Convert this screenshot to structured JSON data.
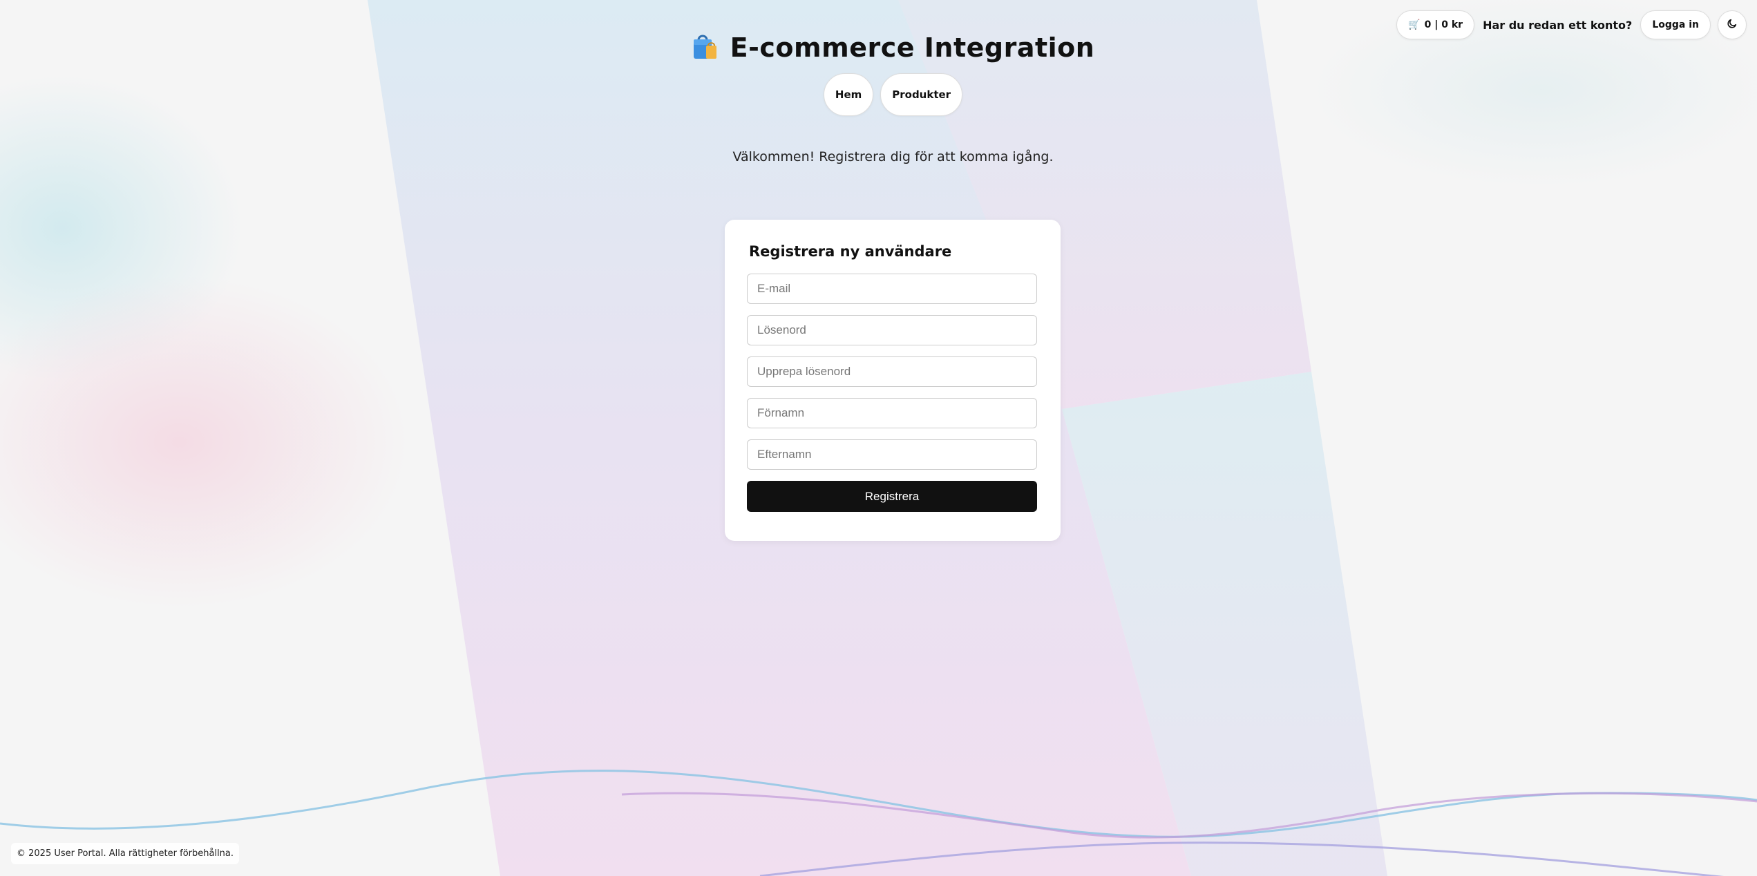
{
  "header": {
    "title": "E-commerce Integration",
    "logo_icon": "shopping-bag-icon"
  },
  "topbar": {
    "cart_icon": "cart-icon",
    "cart_summary": "0 | 0 kr",
    "account_prompt": "Har du redan ett konto?",
    "login_label": "Logga in",
    "theme_icon": "moon-icon"
  },
  "nav": {
    "items": [
      {
        "label": "Hem"
      },
      {
        "label": "Produkter"
      }
    ]
  },
  "welcome": "Välkommen! Registrera dig för att komma igång.",
  "register_form": {
    "title": "Registrera ny användare",
    "fields": [
      {
        "placeholder": "E-mail",
        "value": ""
      },
      {
        "placeholder": "Lösenord",
        "value": ""
      },
      {
        "placeholder": "Upprepa lösenord",
        "value": ""
      },
      {
        "placeholder": "Förnamn",
        "value": ""
      },
      {
        "placeholder": "Efternamn",
        "value": ""
      }
    ],
    "submit_label": "Registrera"
  },
  "footer": {
    "copyright": "© 2025 User Portal. Alla rättigheter förbehållna."
  },
  "colors": {
    "page_background": "#f5f5f5",
    "primary_button": "#111111",
    "wave_blue": "#7fc6e4",
    "wave_purple": "#b79ad8",
    "wave_pink": "#e7a6d2"
  }
}
